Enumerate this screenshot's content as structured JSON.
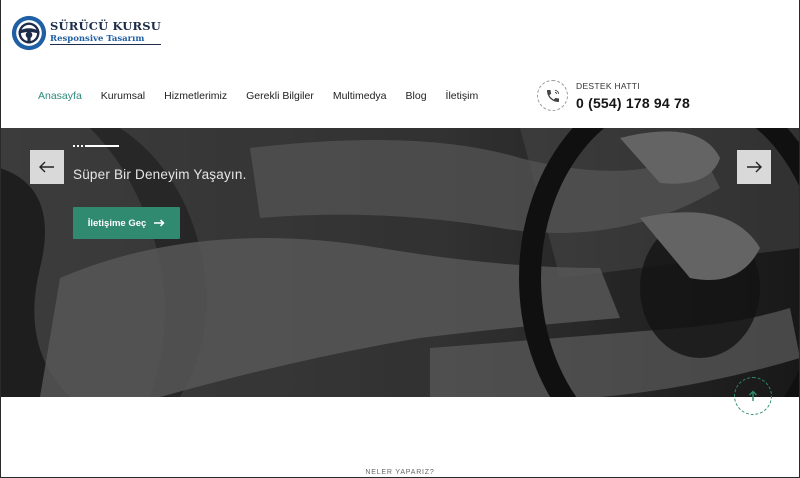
{
  "logo": {
    "title": "SÜRÜCÜ KURSU",
    "subtitle": "Responsive Tasarım",
    "icon": "steering-wheel-icon"
  },
  "nav": {
    "items": [
      {
        "label": "Anasayfa",
        "active": true
      },
      {
        "label": "Kurumsal",
        "active": false
      },
      {
        "label": "Hizmetlerimiz",
        "active": false
      },
      {
        "label": "Gerekli Bilgiler",
        "active": false
      },
      {
        "label": "Multimedya",
        "active": false
      },
      {
        "label": "Blog",
        "active": false
      },
      {
        "label": "İletişim",
        "active": false
      }
    ]
  },
  "support": {
    "label": "DESTEK HATTI",
    "phone": "0 (554) 178 94 78",
    "icon": "phone-icon"
  },
  "hero": {
    "tagline": "Süper Bir Deneyim Yaşayın.",
    "cta_label": "İletişime Geç",
    "prev_icon": "arrow-left-icon",
    "next_icon": "arrow-right-icon"
  },
  "section": {
    "label": "NELER YAPARIZ?"
  },
  "colors": {
    "accent": "#2f8a70",
    "nav_active": "#2e8b7a",
    "logo_dark": "#1c2c49",
    "logo_blue": "#1f5fa3"
  }
}
